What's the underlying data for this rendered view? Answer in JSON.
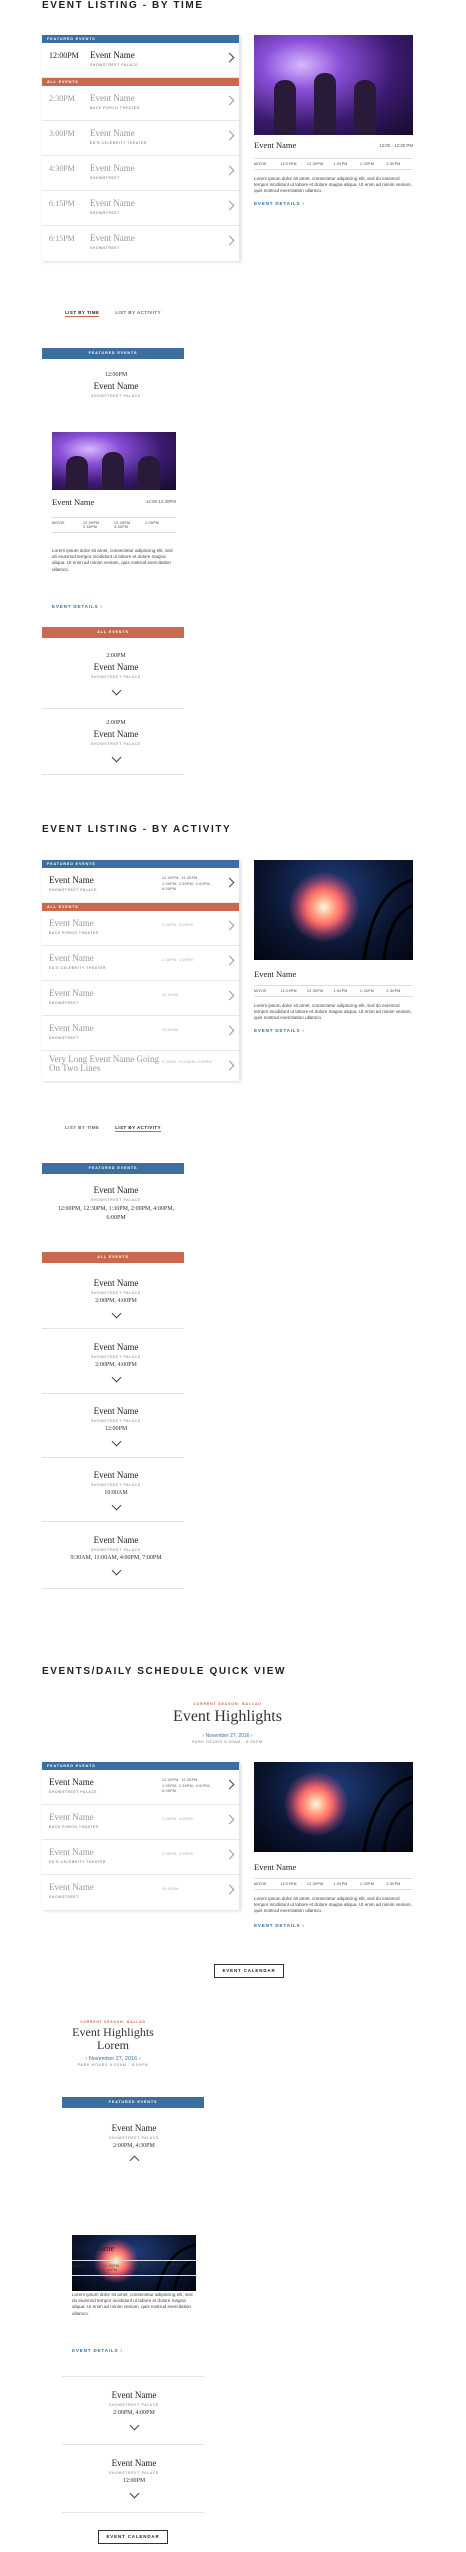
{
  "sections": {
    "by_time": "EVENT LISTING - BY TIME",
    "by_activity": "EVENT LISTING - BY ACTIVITY",
    "quick_view": "EVENTS/DAILY SCHEDULE QUICK VIEW"
  },
  "labels": {
    "featured": "FEATURED EVENTS",
    "all": "ALL EVENTS",
    "event_details": "EVENT DETAILS",
    "event_calendar": "EVENT CALENDAR",
    "tab_time": "LIST BY TIME",
    "tab_activity": "LIST BY ACTIVITY",
    "times_label": "MOVIE"
  },
  "lorem": "Lorem ipsum dolor sit amet, consectetur adipiscing elit, sed do eiusmod tempor incididunt ut labore et dolore magna aliqua. Ut enim ad minim veniam, quis nostrud exercitation ullamco.",
  "by_time": {
    "featured": [
      {
        "time": "12:00PM",
        "name": "Event Name",
        "venue": "SHOWSTREET PALACE"
      }
    ],
    "all": [
      {
        "time": "2:30PM",
        "name": "Event Name",
        "venue": "BACK PORCH THEATER"
      },
      {
        "time": "3:00PM",
        "name": "Event Name",
        "venue": "ED'S CELEBRITY THEATER"
      },
      {
        "time": "4:30PM",
        "name": "Event Name",
        "venue": "SHOWSTREET"
      },
      {
        "time": "6:15PM",
        "name": "Event Name",
        "venue": "SHOWSTREET"
      },
      {
        "time": "6:15PM",
        "name": "Event Name",
        "venue": "SHOWSTREET"
      }
    ],
    "detail": {
      "name": "Event Name",
      "time": "12:00 - 12:30 PM",
      "chips": [
        "MOVIE",
        "12:00PM",
        "12:30PM",
        "1:00PM",
        "1:30PM",
        "2:30PM"
      ]
    },
    "mobile": {
      "featured": {
        "time": "12:00PM",
        "name": "Event Name",
        "venue": "SHOWSTREET PALACE"
      },
      "detail": {
        "name": "Event Name",
        "time": "12:00-12:30PM",
        "chips": [
          "MOVIE",
          "12:30PM",
          "12:30PM",
          "1:00PM",
          "2:30PM",
          "4:30PM"
        ]
      },
      "all": [
        {
          "time": "2:00PM",
          "name": "Event Name",
          "venue": "SHOWSTREET PALACE"
        },
        {
          "time": "2:00PM",
          "name": "Event Name",
          "venue": "SHOWSTREET PALACE"
        }
      ]
    }
  },
  "by_activity": {
    "featured": [
      {
        "name": "Event Name",
        "venue": "SHOWSTREET PALACE",
        "times": "12:00PM, 12:30PM, 1:00PM, 2:30PM, 4:00PM, 6:00PM"
      }
    ],
    "all": [
      {
        "name": "Event Name",
        "venue": "BACK PORCH THEATER",
        "times": "2:00PM, 4:00PM"
      },
      {
        "name": "Event Name",
        "venue": "ED'S CELEBRITY THEATER",
        "times": "2:00PM, 4:00PM"
      },
      {
        "name": "Event Name",
        "venue": "SHOWSTREET",
        "times": "10:00AM"
      },
      {
        "name": "Event Name",
        "venue": "SHOWSTREET",
        "times": "10:00AM"
      },
      {
        "name": "Very Long Event Name Going On Two Lines",
        "venue": "",
        "times": "9:30AM, 11:00AM, 4:00PM"
      }
    ],
    "detail": {
      "name": "Event Name",
      "chips": [
        "MOVIE",
        "12:00PM",
        "12:30PM",
        "1:00PM",
        "1:30PM",
        "2:30PM"
      ]
    },
    "mobile": {
      "featured": {
        "name": "Event Name",
        "venue": "SHOWSTREET PALACE",
        "times": "12:00PM, 12:30PM, 1:30PM, 2:00PM, 4:00PM, 6:00PM"
      },
      "all": [
        {
          "name": "Event Name",
          "venue": "SHOWSTREET PALACE",
          "times": "2:00PM, 4:00PM"
        },
        {
          "name": "Event Name",
          "venue": "SHOWSTREET PALACE",
          "times": "2:00PM, 4:00PM"
        },
        {
          "name": "Event Name",
          "venue": "SHOWSTREET PALACE",
          "times": "12:00PM"
        },
        {
          "name": "Event Name",
          "venue": "SHOWSTREET PALACE",
          "times": "10:00AM"
        },
        {
          "name": "Event Name",
          "venue": "SHOWSTREET PALACE",
          "times": "9:30AM, 11:00AM, 4:00PM, 7:00PM"
        }
      ]
    }
  },
  "quick": {
    "kicker": "CURRENT SEASON: BALLAD",
    "title": "Event Highlights",
    "title_mobile_1": "Event Highlights",
    "title_mobile_2": "Lorem",
    "date": "November 27, 2016",
    "hours": "PARK HOURS 9:00AM - 8:00PM",
    "rows": [
      {
        "name": "Event Name",
        "venue": "SHOWSTREET PALACE",
        "times": "12:00PM, 12:30PM, 1:00PM, 2:30PM, 4:00PM, 6:00PM"
      },
      {
        "name": "Event Name",
        "venue": "BACK PORCH THEATER",
        "times": "2:00PM, 4:00PM"
      },
      {
        "name": "Event Name",
        "venue": "ED'S CELEBRITY THEATER",
        "times": "2:00PM, 4:00PM"
      },
      {
        "name": "Event Name",
        "venue": "SHOWSTREET",
        "times": "10:00AM"
      }
    ],
    "detail": {
      "name": "Event Name",
      "chips": [
        "MOVIE",
        "12:00PM",
        "12:30PM",
        "1:00PM",
        "1:30PM",
        "2:30PM"
      ]
    },
    "mobile": {
      "featured": {
        "name": "Event Name",
        "venue": "SHOWSTREET PALACE",
        "times": "2:00PM, 4:30PM"
      },
      "detail": {
        "name": "Event Name",
        "chips": [
          "MOVIE",
          "12:00PM",
          "12:30PM",
          "1:00PM",
          "2:30PM",
          "4:00PM"
        ]
      },
      "all": [
        {
          "name": "Event Name",
          "venue": "SHOWSTREET PALACE",
          "times": "2:00PM, 4:00PM"
        },
        {
          "name": "Event Name",
          "venue": "SHOWSTREET PALACE",
          "times": "12:00PM"
        }
      ]
    }
  }
}
